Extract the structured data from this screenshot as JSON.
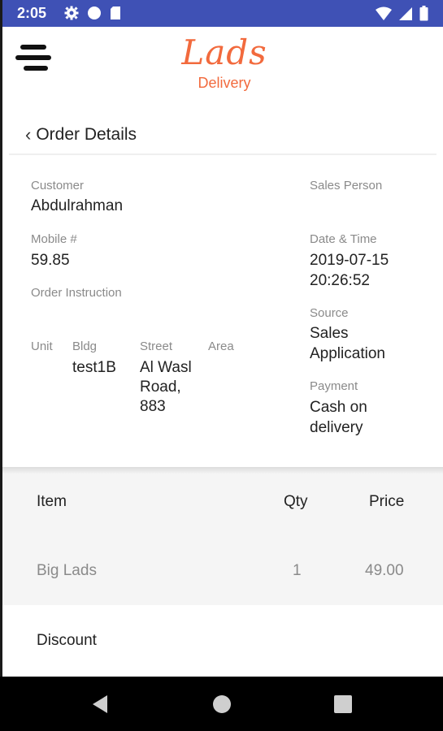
{
  "status_bar": {
    "time": "2:05",
    "color": "#3f51b5",
    "left_icons": [
      "settings-gear-icon",
      "circle-status-icon",
      "sim-card-icon"
    ],
    "right_icons": [
      "wifi-icon",
      "cell-signal-icon",
      "battery-icon"
    ]
  },
  "header": {
    "logo_script": "Lads",
    "logo_sub": "Delivery",
    "brand_color": "#f26a3d"
  },
  "title_bar": {
    "title": "Order Details"
  },
  "order": {
    "customer_label": "Customer",
    "customer_value": "Abdulrahman",
    "sales_person_label": "Sales Person",
    "mobile_label": "Mobile #",
    "mobile_value": "59.85",
    "date_label": "Date & Time",
    "date_value": "2019-07-15",
    "time_value": "20:26:52",
    "instruction_label": "Order Instruction",
    "source_label": "Source",
    "source_value_1": "Sales",
    "source_value_2": "Application",
    "unit_label": "Unit",
    "bldg_label": "Bldg",
    "bldg_value": "test1B",
    "street_label": "Street",
    "street_value_1": "Al Wasl",
    "street_value_2": "Road,",
    "street_value_3": "883",
    "area_label": "Area",
    "payment_label": "Payment",
    "payment_value_1": "Cash on",
    "payment_value_2": "delivery"
  },
  "items_table": {
    "headers": {
      "item": "Item",
      "qty": "Qty",
      "price": "Price"
    },
    "rows": [
      {
        "item": "Big Lads",
        "qty": "1",
        "price": "49.00"
      }
    ]
  },
  "summary": {
    "discount_label": "Discount"
  },
  "nav_bar": {
    "buttons": [
      "back-triangle-icon",
      "home-circle-icon",
      "recents-square-icon"
    ]
  }
}
